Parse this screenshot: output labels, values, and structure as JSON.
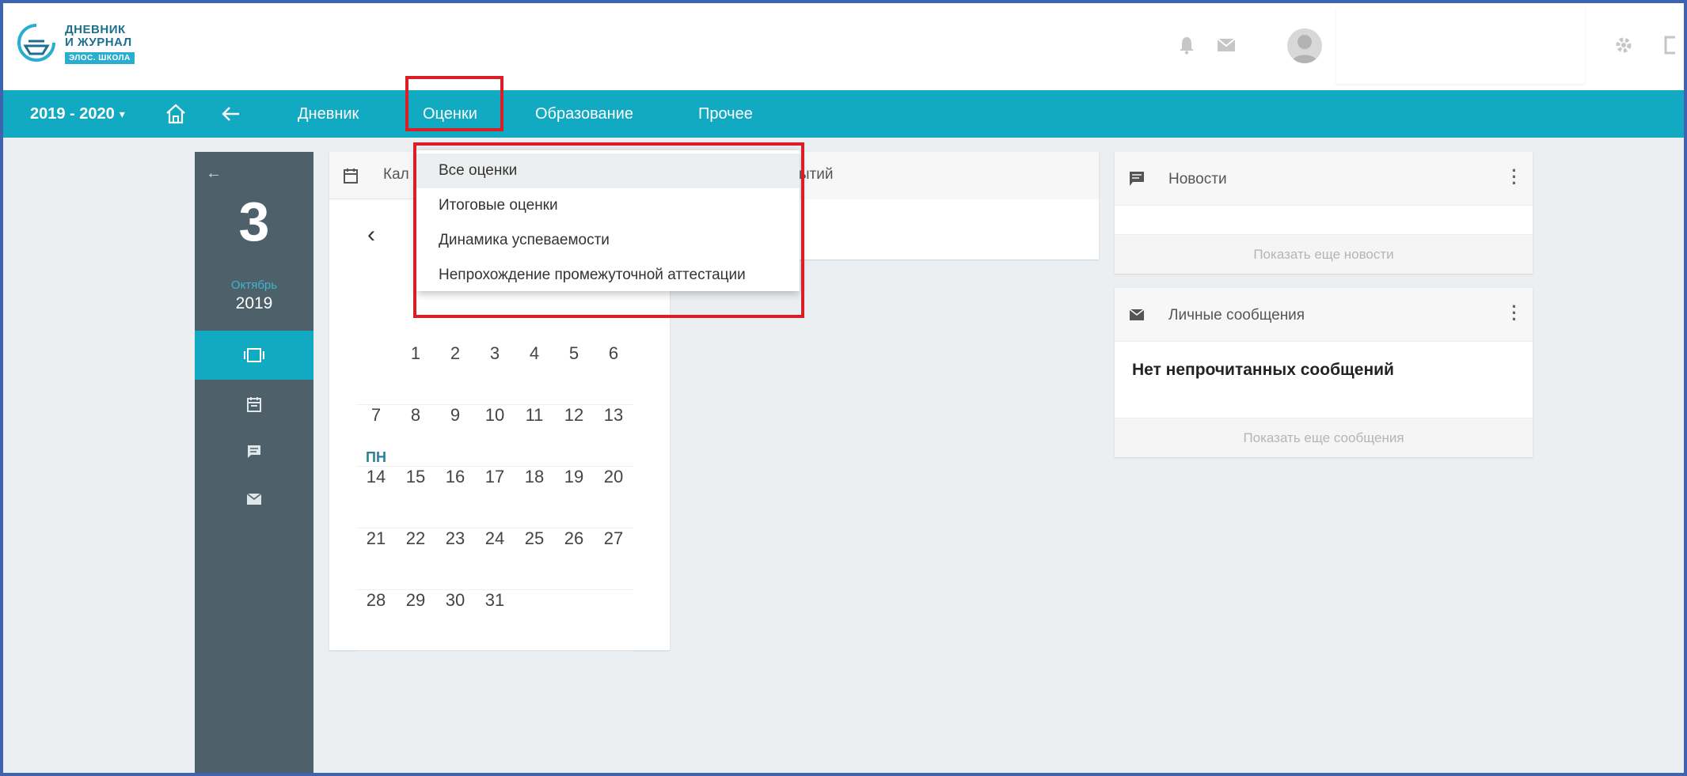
{
  "app": {
    "logo_line1": "ДНЕВНИК",
    "logo_line2": "И ЖУРНАЛ",
    "logo_badge": "ЭЛОС. ШКОЛА"
  },
  "navbar": {
    "year": "2019 - 2020",
    "items": [
      "Дневник",
      "Оценки",
      "Образование",
      "Прочее"
    ],
    "accent_color": "#12a9c2"
  },
  "grades_menu": {
    "items": [
      "Все оценки",
      "Итоговые оценки",
      "Динамика успеваемости",
      "Непрохождение промежуточной аттестации"
    ],
    "selected_index": 0,
    "highlight_color": "#d91e25"
  },
  "sidebar": {
    "day": "3",
    "month": "Октябрь",
    "year": "2019"
  },
  "calendar": {
    "title": "Кал",
    "weekday_label": "ПН",
    "weeks": [
      [
        "",
        "1",
        "2",
        "3",
        "4",
        "5",
        "6"
      ],
      [
        "7",
        "8",
        "9",
        "10",
        "11",
        "12",
        "13"
      ],
      [
        "14",
        "15",
        "16",
        "17",
        "18",
        "19",
        "20"
      ],
      [
        "21",
        "22",
        "23",
        "24",
        "25",
        "26",
        "27"
      ],
      [
        "28",
        "29",
        "30",
        "31",
        "",
        "",
        ""
      ]
    ]
  },
  "events": {
    "title": "бытий"
  },
  "news": {
    "title": "Новости",
    "more": "Показать еще новости"
  },
  "messages": {
    "title": "Личные сообщения",
    "empty": "Нет непрочитанных сообщений",
    "more": "Показать еще сообщения"
  }
}
